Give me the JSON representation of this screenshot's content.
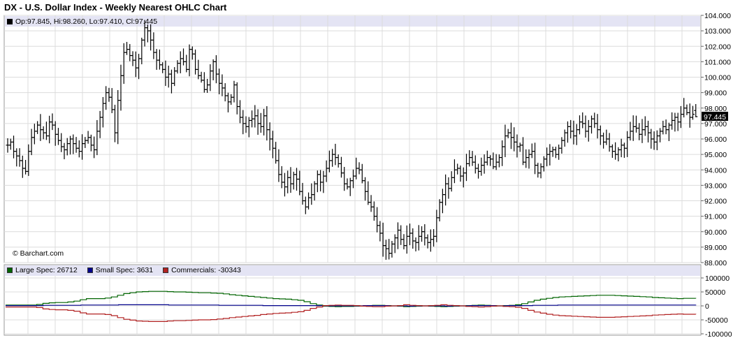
{
  "title": "DX - U.S. Dollar Index - Weekly Nearest OHLC Chart",
  "ohlc_info": "Op:97.845, Hi:98.260, Lo:97.410, Cl:97.445",
  "credit": "© Barchart.com",
  "last_price_label": "97.445",
  "colors": {
    "price_bar": "#000000",
    "large_spec": "#006400",
    "small_spec": "#00008b",
    "commercials": "#b22222",
    "grid": "#dcdcdc",
    "header_band": "#e4e4f4"
  },
  "legend": [
    {
      "label": "Large Spec: 26712",
      "color": "#006400"
    },
    {
      "label": "Small Spec: 3631",
      "color": "#00008b"
    },
    {
      "label": "Commercials: -30343",
      "color": "#b22222"
    }
  ],
  "chart_data": [
    {
      "type": "ohlc",
      "title": "DX - U.S. Dollar Index - Weekly Nearest OHLC Chart",
      "ylim": [
        88,
        104
      ],
      "y_ticks": [
        "88.000",
        "89.000",
        "90.000",
        "91.000",
        "92.000",
        "93.000",
        "94.000",
        "95.000",
        "96.000",
        "97.000",
        "98.000",
        "99.000",
        "100.000",
        "101.000",
        "102.000",
        "103.000",
        "104.000"
      ],
      "close": [
        95.6,
        95.8,
        95.2,
        94.9,
        94.6,
        94.1,
        93.9,
        95.2,
        96.1,
        96.5,
        96.9,
        96.6,
        96.4,
        96.2,
        97.1,
        96.9,
        96.3,
        95.9,
        95.5,
        95.3,
        95.7,
        96.0,
        95.7,
        95.4,
        95.2,
        95.7,
        95.9,
        96.1,
        95.6,
        95.3,
        96.5,
        97.4,
        98.3,
        99.0,
        98.7,
        97.9,
        96.4,
        98.5,
        100.1,
        101.6,
        101.8,
        101.4,
        101.1,
        100.6,
        101.2,
        102.4,
        103.2,
        103.0,
        102.4,
        101.6,
        101.1,
        100.8,
        100.5,
        100.0,
        100.2,
        99.6,
        100.4,
        100.9,
        101.2,
        101.0,
        100.5,
        101.8,
        101.5,
        100.5,
        100.1,
        99.8,
        99.2,
        99.5,
        100.4,
        101.0,
        100.2,
        99.6,
        99.3,
        98.8,
        98.4,
        98.7,
        99.5,
        98.1,
        97.4,
        97.0,
        96.8,
        97.2,
        97.3,
        97.5,
        97.0,
        96.8,
        97.5,
        96.6,
        96.0,
        95.4,
        94.6,
        93.7,
        93.2,
        92.9,
        93.5,
        93.1,
        93.7,
        93.4,
        92.6,
        92.0,
        91.6,
        92.2,
        92.4,
        93.1,
        93.7,
        93.2,
        93.6,
        94.1,
        94.6,
        95.0,
        94.8,
        94.4,
        93.8,
        93.1,
        92.9,
        93.3,
        93.6,
        94.1,
        94.0,
        93.3,
        92.6,
        91.9,
        91.6,
        91.0,
        90.4,
        89.9,
        89.1,
        88.9,
        88.6,
        89.2,
        89.6,
        90.1,
        89.5,
        89.1,
        89.7,
        89.9,
        89.4,
        89.3,
        89.7,
        90.0,
        89.6,
        89.3,
        89.5,
        89.7,
        90.9,
        91.9,
        92.4,
        93.1,
        92.8,
        93.5,
        94.0,
        94.1,
        93.6,
        93.8,
        94.4,
        94.8,
        94.5,
        94.1,
        93.9,
        94.3,
        94.5,
        94.8,
        94.7,
        94.2,
        94.5,
        94.8,
        95.5,
        96.2,
        96.4,
        96.1,
        95.8,
        95.5,
        95.6,
        94.5,
        94.8,
        95.0,
        95.2,
        94.3,
        93.8,
        94.2,
        94.7,
        95.0,
        95.2,
        95.3,
        95.0,
        95.4,
        95.9,
        96.4,
        96.8,
        96.5,
        96.2,
        96.6,
        97.1,
        97.0,
        96.5,
        96.8,
        97.3,
        97.0,
        96.6,
        96.2,
        95.8,
        96.0,
        95.5,
        95.2,
        95.0,
        95.3,
        95.6,
        95.4,
        96.1,
        96.5,
        96.8,
        96.7,
        96.3,
        96.6,
        96.8,
        96.4,
        96.0,
        95.8,
        96.2,
        96.5,
        96.8,
        96.6,
        96.9,
        97.2,
        97.4,
        97.1,
        97.6,
        98.0,
        97.7,
        97.4,
        97.6,
        97.445
      ],
      "high_low_range_note": "weekly bars, final bar Op:97.845 Hi:98.260 Lo:97.410 Cl:97.445"
    },
    {
      "type": "line",
      "ylim": [
        -100000,
        100000
      ],
      "y_ticks": [
        "100000",
        "50000",
        "0",
        "-50000",
        "-100000"
      ],
      "series": [
        {
          "name": "Large Spec",
          "values": [
            3000,
            3000,
            3000,
            3000,
            3000,
            5000,
            9000,
            11000,
            12000,
            12000,
            14000,
            17000,
            22000,
            26000,
            26000,
            26000,
            28000,
            32000,
            38000,
            44000,
            47000,
            50000,
            51000,
            52000,
            52000,
            52000,
            51000,
            50000,
            50000,
            49000,
            48000,
            47000,
            47000,
            46000,
            45000,
            43000,
            40000,
            38000,
            36000,
            34000,
            32000,
            30000,
            28000,
            26000,
            25000,
            24000,
            22000,
            20000,
            15000,
            8000,
            3000,
            -1000,
            -2000,
            -3000,
            -2000,
            -2000,
            -1000,
            0,
            1000,
            2000,
            2000,
            1000,
            0,
            -1000,
            -3000,
            -2000,
            -1000,
            0,
            -1000,
            -2000,
            -3000,
            -2000,
            -1000,
            0,
            1000,
            2000,
            3000,
            2000,
            1000,
            0,
            1000,
            2000,
            4000,
            8000,
            14000,
            20000,
            24000,
            27000,
            30000,
            32000,
            33000,
            34000,
            35000,
            36000,
            37000,
            38000,
            38000,
            38000,
            37000,
            36000,
            35000,
            34000,
            33000,
            32000,
            30000,
            29000,
            28000,
            27000,
            26000,
            27000,
            27000,
            26712
          ]
        },
        {
          "name": "Small Spec",
          "values": [
            1000,
            1000,
            1000,
            1000,
            1000,
            1000,
            2000,
            2000,
            2000,
            2000,
            2000,
            2000,
            3000,
            3000,
            3000,
            3000,
            3000,
            3000,
            4000,
            4000,
            4000,
            4000,
            4000,
            4000,
            4000,
            4000,
            3000,
            3000,
            3000,
            3000,
            3000,
            3000,
            3000,
            3000,
            2000,
            2000,
            2000,
            2000,
            2000,
            2000,
            2000,
            1000,
            1000,
            1000,
            1000,
            1000,
            1000,
            1000,
            1000,
            1000,
            1000,
            0,
            0,
            0,
            0,
            0,
            0,
            1000,
            1000,
            1000,
            1000,
            0,
            0,
            0,
            -1000,
            0,
            0,
            0,
            0,
            0,
            -1000,
            0,
            0,
            0,
            1000,
            1000,
            1000,
            1000,
            0,
            0,
            1000,
            1000,
            1000,
            1000,
            2000,
            2000,
            2000,
            2000,
            3000,
            3000,
            3000,
            3000,
            3000,
            3000,
            3000,
            3000,
            3000,
            3000,
            3000,
            3000,
            3000,
            3000,
            3000,
            3000,
            3000,
            3000,
            3000,
            3000,
            3000,
            3000,
            3631
          ]
        },
        {
          "name": "Commercials",
          "values": [
            -4000,
            -4000,
            -4000,
            -4000,
            -4000,
            -6000,
            -11000,
            -13000,
            -14000,
            -14000,
            -16000,
            -19000,
            -25000,
            -29000,
            -29000,
            -29000,
            -31000,
            -35000,
            -42000,
            -48000,
            -51000,
            -54000,
            -55000,
            -56000,
            -56000,
            -56000,
            -54000,
            -53000,
            -53000,
            -52000,
            -51000,
            -50000,
            -50000,
            -49000,
            -47000,
            -45000,
            -42000,
            -40000,
            -38000,
            -36000,
            -34000,
            -31000,
            -29000,
            -27000,
            -26000,
            -25000,
            -23000,
            -21000,
            -16000,
            -9000,
            -4000,
            1000,
            2000,
            3000,
            2000,
            2000,
            1000,
            -1000,
            -2000,
            -3000,
            -3000,
            -1000,
            0,
            1000,
            4000,
            2000,
            1000,
            0,
            1000,
            2000,
            4000,
            2000,
            1000,
            0,
            -2000,
            -3000,
            -4000,
            -3000,
            -1000,
            0,
            -2000,
            -3000,
            -5000,
            -9000,
            -16000,
            -22000,
            -26000,
            -30000,
            -33000,
            -35000,
            -36000,
            -37000,
            -38000,
            -39000,
            -40000,
            -41000,
            -41000,
            -41000,
            -40000,
            -39000,
            -38000,
            -37000,
            -36000,
            -35000,
            -33000,
            -32000,
            -31000,
            -30000,
            -29000,
            -30000,
            -30000,
            -30343
          ]
        }
      ]
    }
  ]
}
